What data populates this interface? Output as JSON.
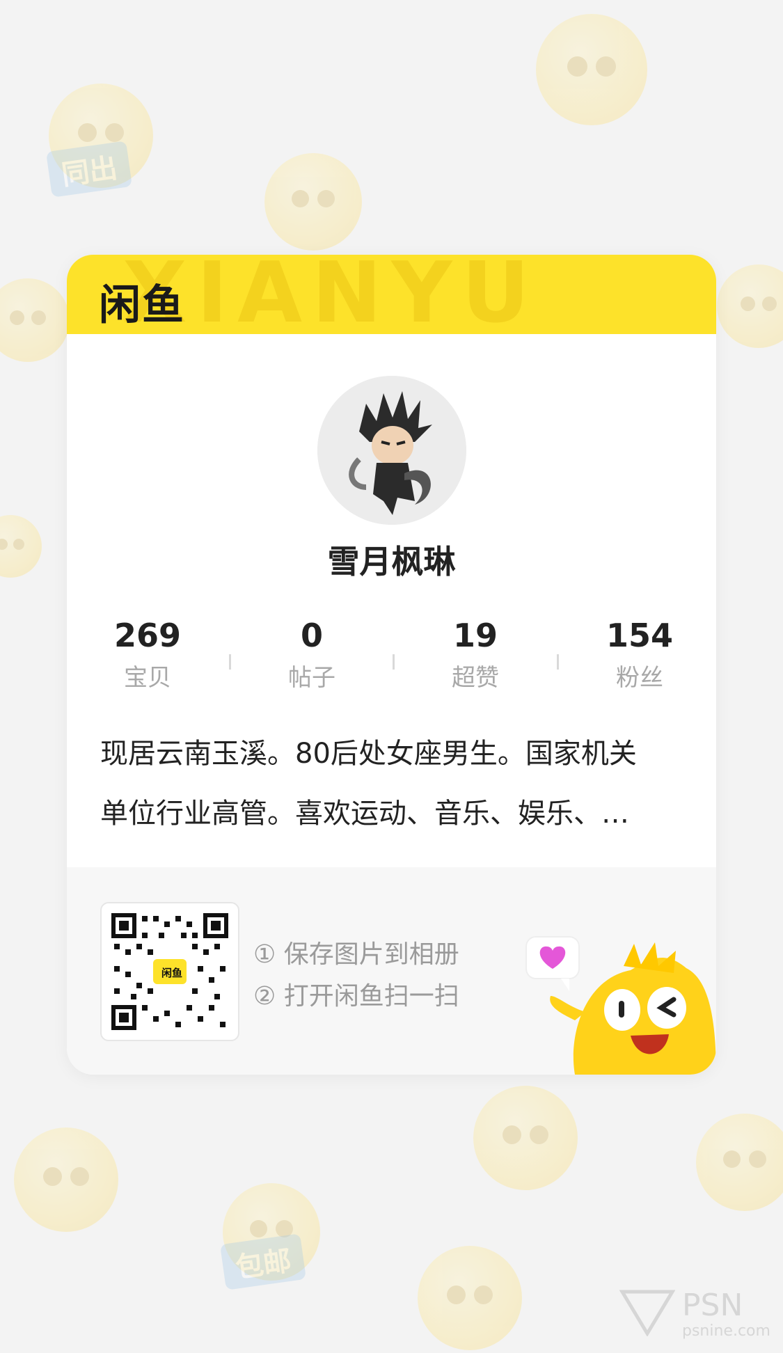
{
  "brand": {
    "name": "闲鱼",
    "watermark": "XIANYU"
  },
  "profile": {
    "username": "雪月枫琳"
  },
  "stats": [
    {
      "value": "269",
      "label": "宝贝"
    },
    {
      "value": "0",
      "label": "帖子"
    },
    {
      "value": "19",
      "label": "超赞"
    },
    {
      "value": "154",
      "label": "粉丝"
    }
  ],
  "bio": {
    "line1": "现居云南玉溪。80后处女座男生。国家机关",
    "line2": "单位行业高管。喜欢运动、音乐、娱乐、…"
  },
  "share": {
    "qr_badge": "闲鱼",
    "step1": "① 保存图片到相册",
    "step2": "② 打开闲鱼扫一扫"
  },
  "background": {
    "tag1": "同出",
    "tag2": "包邮"
  },
  "watermark_site": {
    "title": "PSN",
    "sub": "psnine.com"
  },
  "colors": {
    "brand_yellow": "#fde22a",
    "text_dark": "#222222",
    "text_muted": "#a8a8a8"
  }
}
